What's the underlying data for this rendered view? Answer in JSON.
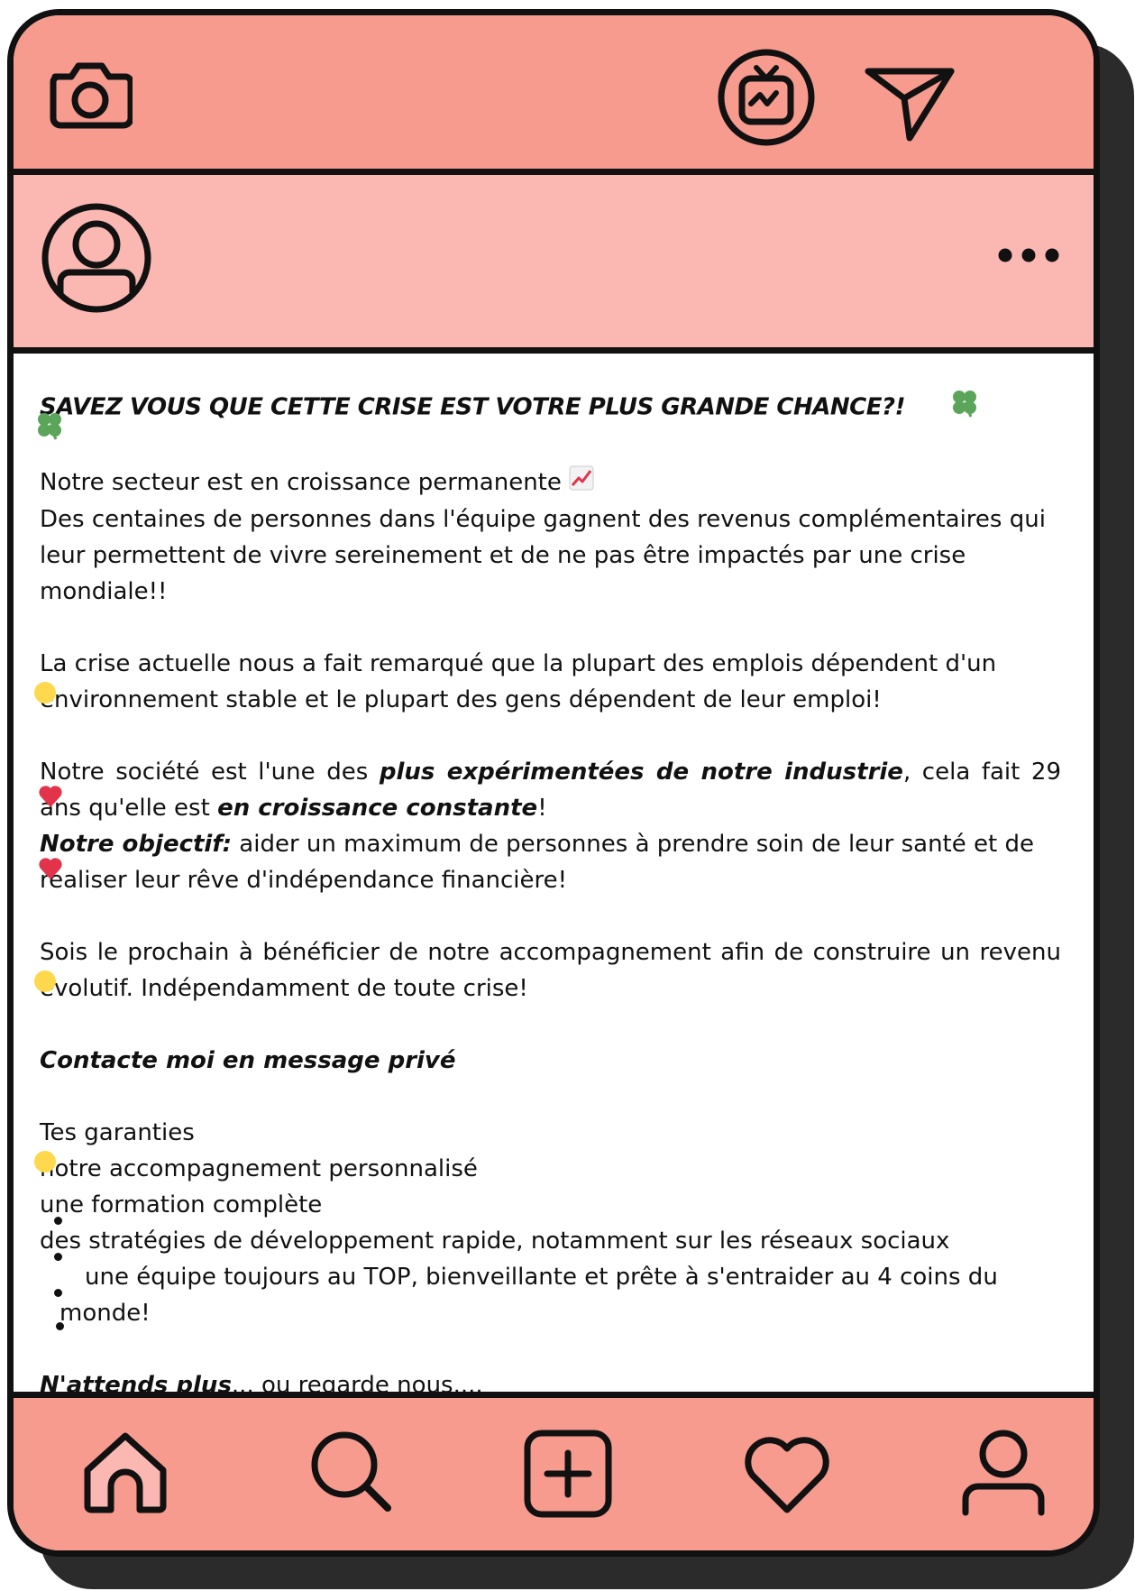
{
  "top_bar": {
    "icons": [
      "camera-icon",
      "igtv-icon",
      "send-icon"
    ]
  },
  "profile_bar": {
    "icons": [
      "avatar-icon",
      "more-options-icon"
    ]
  },
  "post": {
    "headline": "SAVEZ VOUS QUE CETTE CRISE EST VOTRE PLUS GRANDE CHANCE?!",
    "p1_line1": "Notre secteur est en croissance permanente",
    "p1_line2": "Des centaines de personnes dans l'équipe gagnent des revenus complémentaires qui leur permettent de vivre sereinement et de ne pas être impactés par une crise mondiale!!",
    "p2": "La crise actuelle nous a fait remarqué que la plupart des emplois dépendent d'un environnement stable et le plupart des gens dépendent de leur emploi!",
    "p3_a": "Notre société est l'une des ",
    "p3_b": "plus expérimentées de notre industrie",
    "p3_c": ", cela fait 29 ans qu'elle est ",
    "p3_d": "en croissance constante",
    "p3_e": "!",
    "p4_a": "Notre objectif:",
    "p4_b": " aider un maximum de personnes à prendre soin de leur santé et de réaliser leur rêve d'indépendance financière!",
    "p5": "Sois le prochain à bénéficier de notre accompagnement afin de construire un revenu évolutif. Indépendamment de toute crise!",
    "contact": "Contacte moi en message privé",
    "guarantees_title": "Tes garanties",
    "guarantees": [
      "notre accompagnement personnalisé",
      "une formation complète",
      "des stratégies de développement rapide, notamment sur les réseaux sociaux",
      "une équipe toujours au TOP, bienveillante et prête à s'entraider au 4 coins du monde!"
    ],
    "closing_bold": "N'attends plus",
    "closing_rest": "... ou regarde nous...."
  },
  "bottom_bar": {
    "icons": [
      "home-icon",
      "search-icon",
      "add-post-icon",
      "heart-icon",
      "profile-icon"
    ]
  },
  "colors": {
    "top_bar": "#f79b8f",
    "profile_bar": "#fbb8b3",
    "outline": "#111111",
    "shadow": "#2b2b2b",
    "clover": "#5ba55a",
    "heart_emoji": "#e2334a",
    "yellow_emoji": "#ffd84d"
  }
}
